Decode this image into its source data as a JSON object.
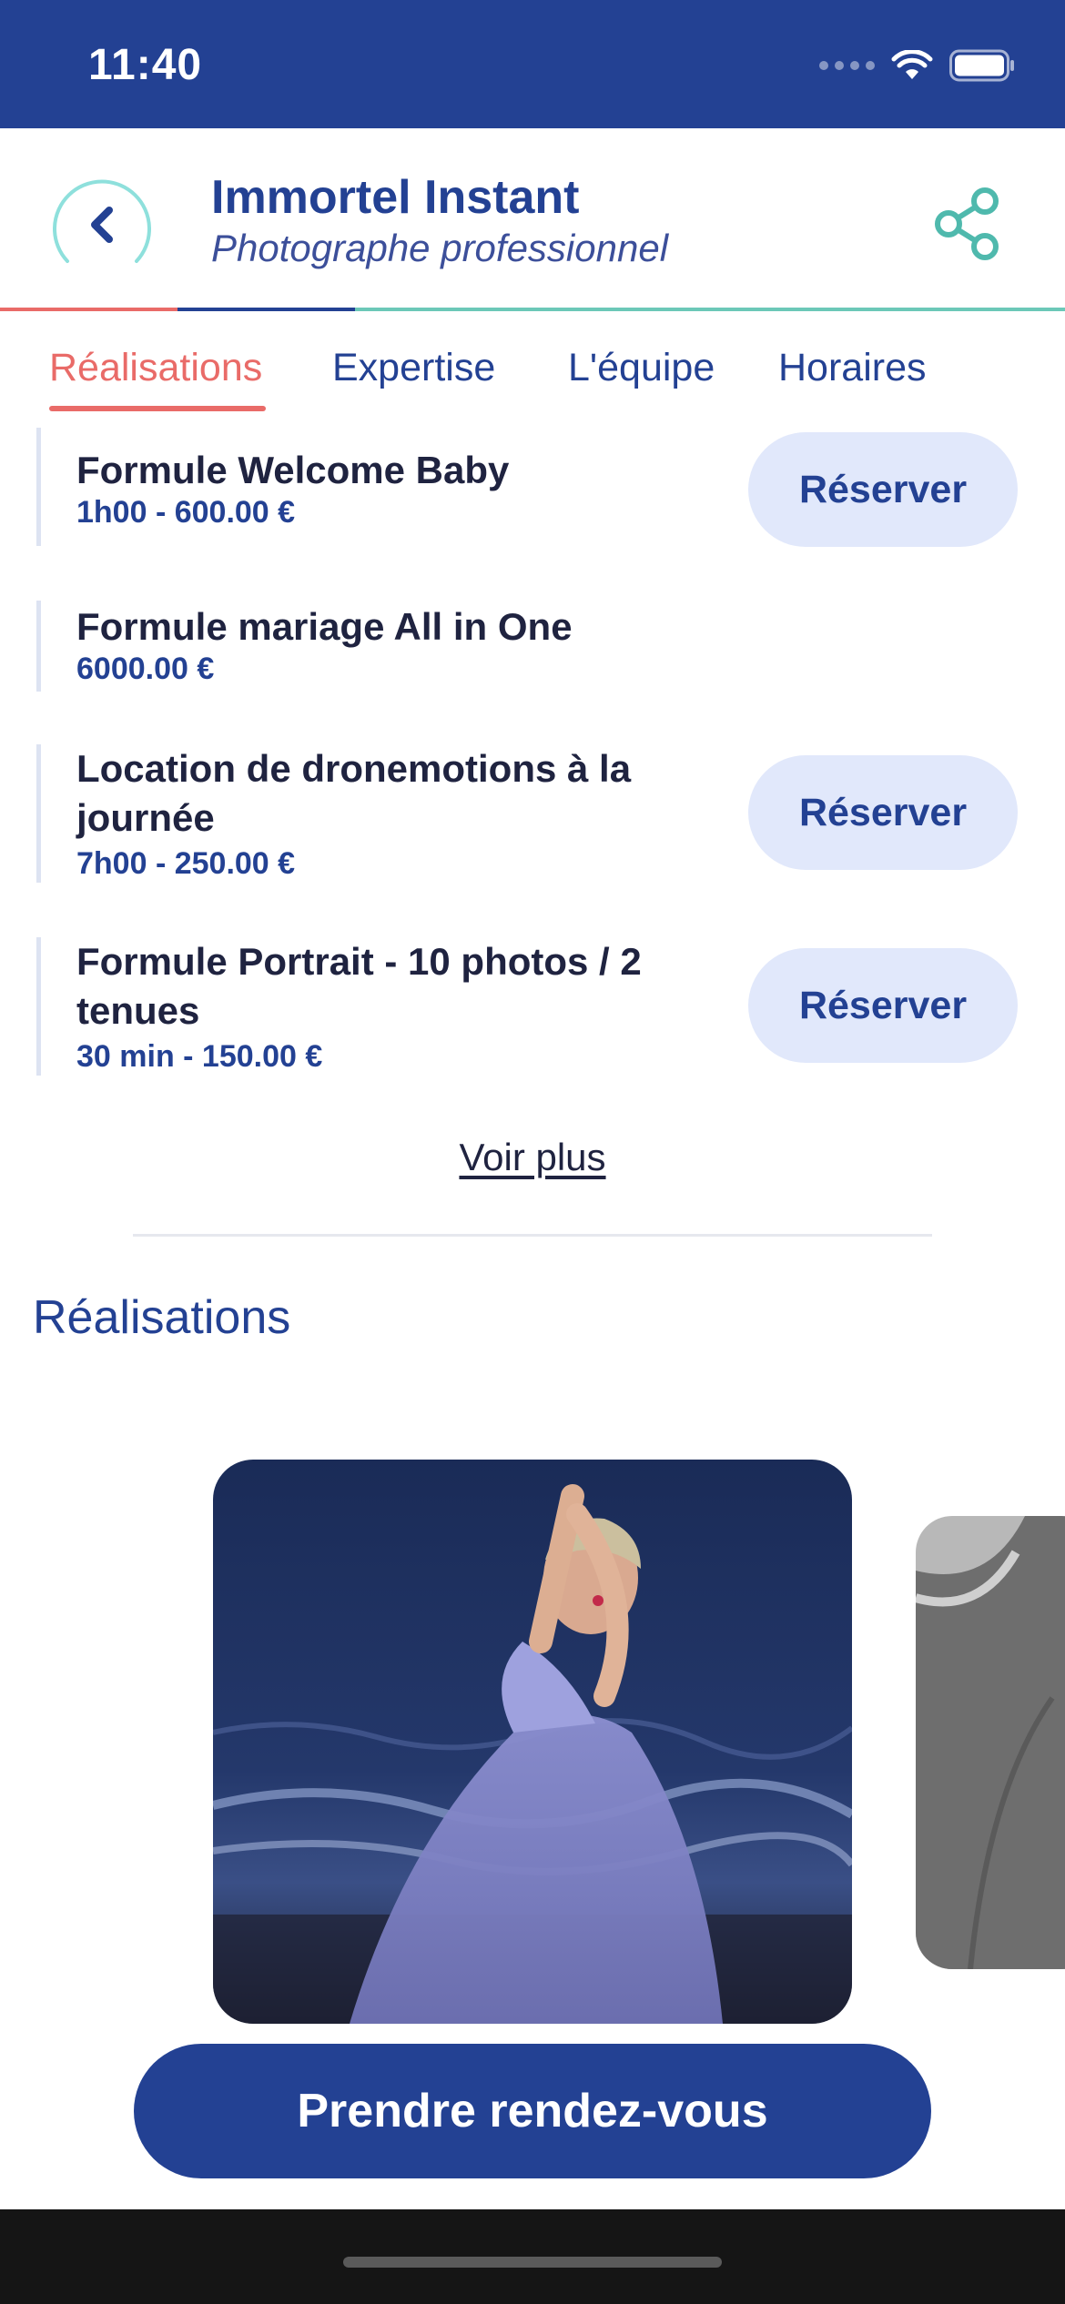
{
  "status_bar": {
    "time": "11:40"
  },
  "header": {
    "title": "Immortel Instant",
    "subtitle": "Photographe professionnel"
  },
  "tabs": [
    {
      "label": "Réalisations",
      "active": true
    },
    {
      "label": "Expertise",
      "active": false
    },
    {
      "label": "L'équipe",
      "active": false
    },
    {
      "label": "Horaires",
      "active": false
    }
  ],
  "services": [
    {
      "name": "Formule Welcome Baby",
      "meta": "1h00 - 600.00 €",
      "reserve_label": "Réserver"
    },
    {
      "name": "Formule mariage All in One",
      "meta": "6000.00 €",
      "reserve_label": ""
    },
    {
      "name": "Location de dronemotions à la journée",
      "meta": "7h00 - 250.00 €",
      "reserve_label": "Réserver"
    },
    {
      "name": "Formule Portrait - 10 photos / 2 tenues",
      "meta": "30 min - 150.00 €",
      "reserve_label": "Réserver"
    }
  ],
  "see_more": "Voir plus",
  "gallery": {
    "title": "Réalisations",
    "photos": [
      "woman-in-blue-dress-at-sea-photo",
      "man-in-suit-bw-photo"
    ]
  },
  "cta": {
    "label": "Prendre rendez-vous"
  },
  "colors": {
    "brand_blue": "#234193",
    "accent_red": "#e96b68",
    "accent_teal": "#6cc8b8",
    "button_light": "#e1e8fb"
  }
}
